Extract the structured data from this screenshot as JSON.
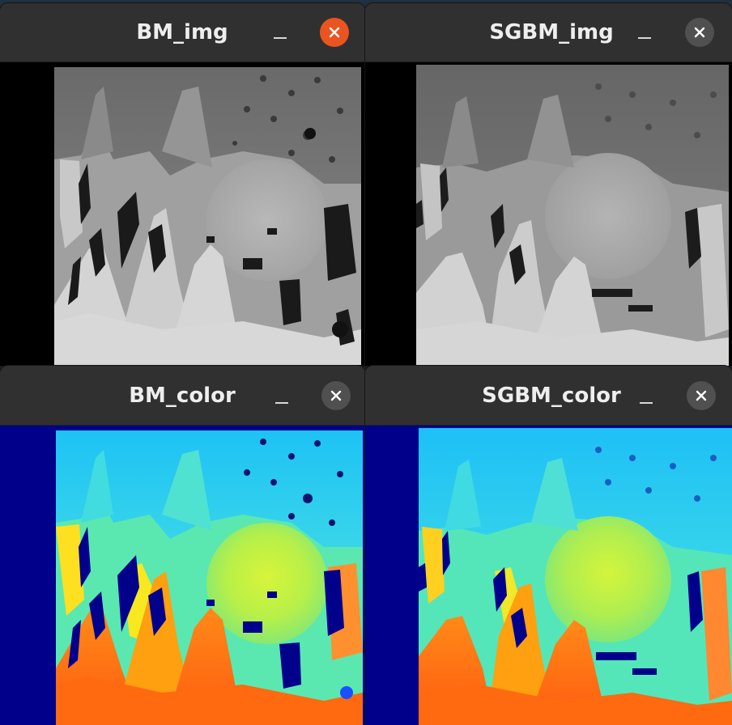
{
  "windows": {
    "bm_img": {
      "title": "BM_img",
      "focused": true
    },
    "sgbm_img": {
      "title": "SGBM_img",
      "focused": false
    },
    "bm_color": {
      "title": "BM_color",
      "focused": false
    },
    "sgbm_color": {
      "title": "SGBM_color",
      "focused": false
    }
  },
  "icons": {
    "minimize": "minimize-icon",
    "close": "close-icon"
  },
  "colors": {
    "titlebar": "#303030",
    "title_text": "#eeeeee",
    "close_active": "#e95420",
    "close_inactive": "#505050",
    "gray_far": "#6a6a6a",
    "gray_near": "#d0d0d0",
    "jet_far": "#27c4f0",
    "jet_mid": "#b8f040",
    "jet_near": "#ff6a10",
    "colormap_min": "#00008b"
  }
}
